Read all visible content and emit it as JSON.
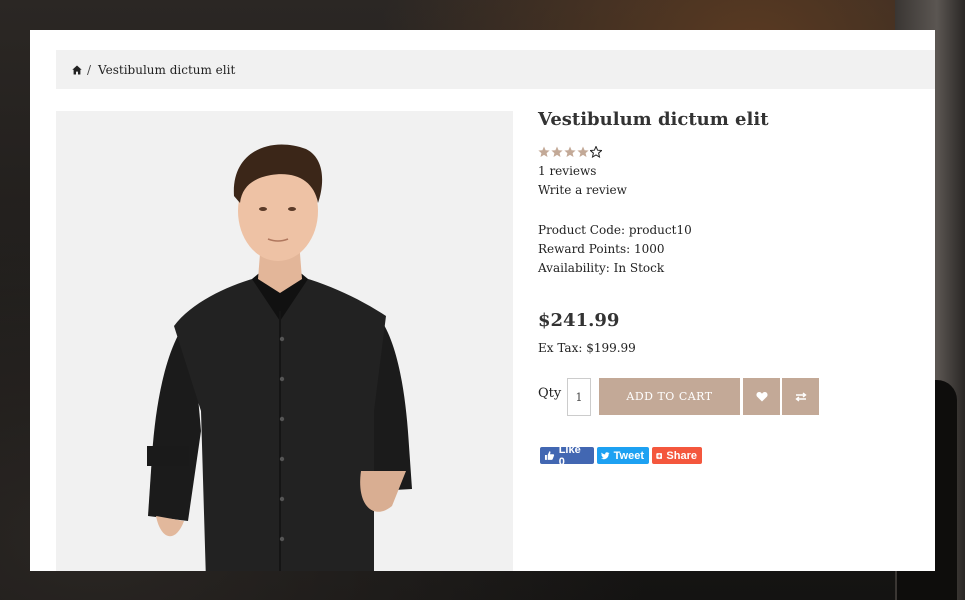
{
  "breadcrumb": {
    "home_icon": "home-icon",
    "separator": "/",
    "current": "Vestibulum dictum elit"
  },
  "product": {
    "title": "Vestibulum dictum elit",
    "rating": {
      "filled": 4,
      "total": 5
    },
    "reviews_link": "1 reviews",
    "write_review_link": "Write a review",
    "code_line": "Product Code: product10",
    "reward_line": "Reward Points: 1000",
    "availability_line": "Availability: In Stock",
    "price": "$241.99",
    "ex_tax": "Ex Tax: $199.99",
    "qty_label": "Qty",
    "qty_value": "1",
    "add_to_cart_label": "ADD TO CART",
    "wishlist_icon": "heart-icon",
    "compare_icon": "compare-arrows-icon"
  },
  "social": {
    "facebook_label": "Like 0",
    "twitter_label": "Tweet",
    "share_label": "Share"
  },
  "colors": {
    "accent": "#c3a997",
    "star_filled": "#c3a997",
    "facebook": "#4267b2",
    "twitter": "#1da1f2",
    "share": "#f4573d"
  }
}
